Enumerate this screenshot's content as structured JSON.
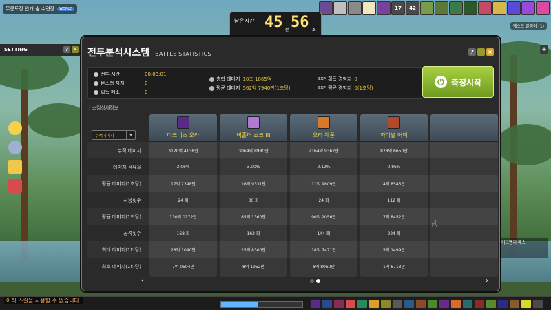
{
  "map": {
    "name": "무릉도장 안개 숲 수련장",
    "world_badge": "WORLD"
  },
  "quest_helper": "퀘스트 알림이 (1)",
  "top_buffs": [
    {
      "label": "",
      "color": "#6a4c93"
    },
    {
      "label": "",
      "color": "#c0c0c0"
    },
    {
      "label": "",
      "color": "#8a8a8a"
    },
    {
      "label": "",
      "color": "#f0e6c0"
    },
    {
      "label": "",
      "color": "#7b3fa0"
    },
    {
      "label": "17",
      "color": "#4a4a4a"
    },
    {
      "label": "42",
      "color": "#4a4a4a"
    },
    {
      "label": "",
      "color": "#7a9b4a"
    },
    {
      "label": "",
      "color": "#5a7a3a"
    },
    {
      "label": "",
      "color": "#3d7a4a"
    },
    {
      "label": "",
      "color": "#2a5a2a"
    },
    {
      "label": "",
      "color": "#c44a6a"
    },
    {
      "label": "",
      "color": "#d9b84a"
    },
    {
      "label": "",
      "color": "#5a4ad9"
    },
    {
      "label": "",
      "color": "#9a4ad9"
    },
    {
      "label": "",
      "color": "#d94aa0"
    }
  ],
  "timer": {
    "label": "남은시간",
    "minutes": "45",
    "minutes_unit": "분",
    "seconds": "56",
    "seconds_unit": "초",
    "sub": "BATTLE STATISTICS"
  },
  "setting_panel": {
    "title": "SETTING"
  },
  "window": {
    "title": "전투분석시스템",
    "subtitle": "BATTLE STATISTICS",
    "help": "?",
    "minimize": "−",
    "close": "×"
  },
  "summary": {
    "battle_time_label": "전투 시간",
    "battle_time": "00:03:01",
    "monsters_label": "몬스터 처치",
    "monsters": "0",
    "mesos_label": "획득 메소",
    "mesos": "0",
    "total_damage_label": "총합 데미지",
    "total_damage": "10조 1865억",
    "avg_damage_label": "평균 데미지",
    "avg_damage": "562억 7940만(1초당)",
    "exp_label": "획득 경험치",
    "exp": "0",
    "avg_exp_label": "평균 경험치",
    "avg_exp": "0(1초당)",
    "exp_tag": "EXP"
  },
  "measure_button": {
    "label": "측정시작",
    "icon": "⏻"
  },
  "detail": {
    "header": "| 스킬상세정보",
    "dropdown_value": "누적데미지",
    "row_labels": [
      "누적 데미지",
      "데미지 점유율",
      "평균 데미지(1초당)",
      "사용횟수",
      "평균 데미지(1회당)",
      "공격횟수",
      "최대 데미지(1타당)",
      "최소 데미지(1타당)"
    ],
    "skills": [
      {
        "name": "다크니스 오라",
        "icon_color": "#5a2a8a",
        "values": [
          "3120억 4138만",
          "3.06%",
          "17억 2398만",
          "24 회",
          "130억 0172만",
          "168 회",
          "28억 1090만",
          "7억 0504만"
        ]
      },
      {
        "name": "비홀더 쇼크 III",
        "icon_color": "#b07ad0",
        "values": [
          "3064억 8980만",
          "3.00%",
          "16억 9331만",
          "36 회",
          "85억 1360만",
          "162 회",
          "25억 8300만",
          "8억 1952만"
        ]
      },
      {
        "name": "오라 웨폰",
        "icon_color": "#d97a2a",
        "values": [
          "2164억 9362만",
          "2.12%",
          "11억 9609만",
          "24 회",
          "90억 2056만",
          "144 회",
          "18억 7471만",
          "6억 8060만"
        ]
      },
      {
        "name": "파이널 어택",
        "icon_color": "#b04a2a",
        "values": [
          "878억 6650만",
          "0.86%",
          "4억 8545만",
          "112 회",
          "7억 8452만",
          "224 회",
          "5억 1499만",
          "1억 6713만"
        ]
      },
      {
        "name": "",
        "icon_color": "",
        "values": [
          "",
          "",
          "",
          "",
          "",
          "",
          "",
          ""
        ]
      }
    ]
  },
  "pager": {
    "prev": "‹",
    "next": "›",
    "page_count": 2,
    "active_page": 2
  },
  "chat_message": "아직 스킬을 사용할 수 없습니다.",
  "right_widget": "어드벤처 패스",
  "exp_progress": 0.45
}
